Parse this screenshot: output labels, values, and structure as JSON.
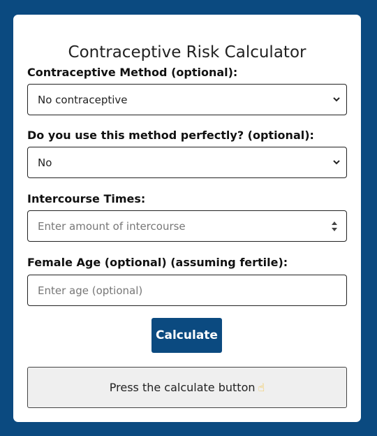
{
  "calculator": {
    "title": "Contraceptive Risk Calculator",
    "method": {
      "label": "Contraceptive Method (optional):",
      "selected": "No contraceptive"
    },
    "perfect_use": {
      "label": "Do you use this method perfectly? (optional):",
      "selected": "No"
    },
    "intercourse": {
      "label": "Intercourse Times:",
      "placeholder": "Enter amount of intercourse"
    },
    "age": {
      "label": "Female Age (optional) (assuming fertile):",
      "placeholder": "Enter age (optional)"
    },
    "calculate_label": "Calculate",
    "result_text": "Press the calculate button",
    "result_emoji": "☝"
  },
  "colors": {
    "background": "#0b4a80",
    "button": "#0b4a80",
    "result_bg": "#efefef"
  },
  "icons": {
    "select_arrow": "chevron-down-icon",
    "number_spinner": "spinner-arrows-icon",
    "pointing_hand": "pointing-up-hand-icon"
  }
}
